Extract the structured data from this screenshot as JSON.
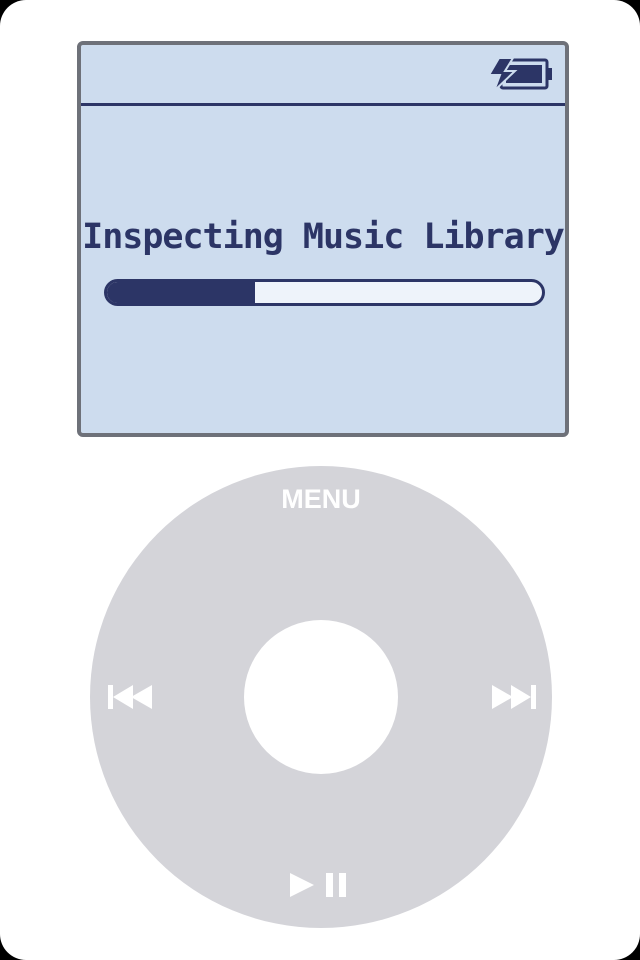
{
  "screen": {
    "message": "Inspecting Music Library",
    "progress_percent": 34,
    "battery_icon": "battery-charging-icon",
    "background_color": "#cddcee",
    "ink_color": "#2c3566"
  },
  "wheel": {
    "menu_label": "MENU",
    "prev_icon": "previous-track-icon",
    "next_icon": "next-track-icon",
    "playpause_icon": "play-pause-icon"
  }
}
